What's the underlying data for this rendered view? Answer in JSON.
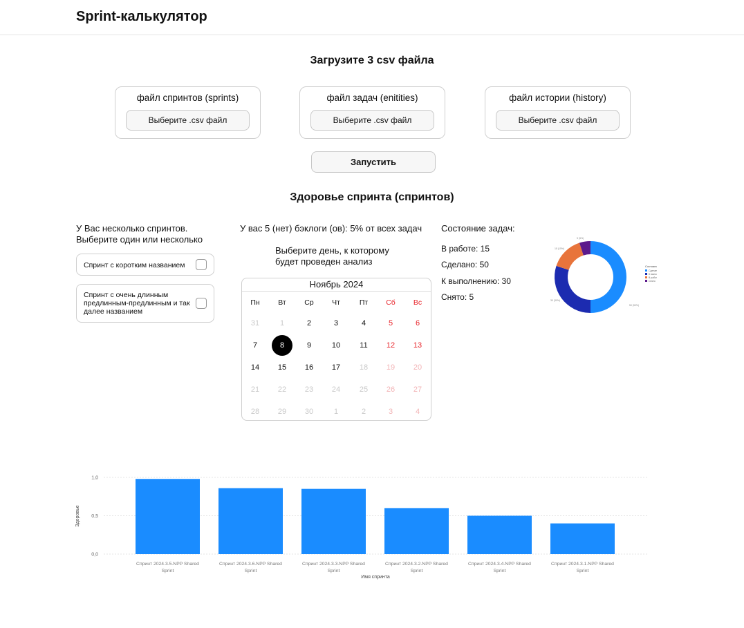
{
  "app": {
    "title": "Sprint-калькулятор"
  },
  "upload": {
    "heading": "Загрузите 3 csv файла",
    "cards": [
      {
        "title": "файл спринтов (sprints)",
        "button": "Выберите .csv файл"
      },
      {
        "title": "файл задач (enitities)",
        "button": "Выберите .csv файл"
      },
      {
        "title": "файл истории (history)",
        "button": "Выберите .csv файл"
      }
    ],
    "run_label": "Запустить"
  },
  "health": {
    "heading": "Здоровье спринта (спринтов)"
  },
  "sprints": {
    "prompt_line1": "У Вас несколько спринтов.",
    "prompt_line2": "Выберите один или несколько",
    "options": [
      {
        "label": "Спринт с коротким названием",
        "checked": false
      },
      {
        "label": "Спринт с очень длинным предлинным-предлинным и так далее названием",
        "checked": false
      }
    ]
  },
  "backlog": {
    "text": "У вас 5 (нет) бэклоги (ов): 5% от всех задач"
  },
  "day_picker": {
    "prompt_line1": "Выберите день, к которому",
    "prompt_line2": "будет проведен анализ",
    "month_label": "Ноябрь 2024",
    "weekdays": [
      "Пн",
      "Вт",
      "Ср",
      "Чт",
      "Пт",
      "Сб",
      "Вс"
    ],
    "weeks": [
      [
        "31",
        "1",
        "2",
        "3",
        "4",
        "5",
        "6"
      ],
      [
        "7",
        "8",
        "9",
        "10",
        "11",
        "12",
        "13"
      ],
      [
        "14",
        "15",
        "16",
        "17",
        "18",
        "19",
        "20"
      ],
      [
        "21",
        "22",
        "23",
        "24",
        "25",
        "26",
        "27"
      ],
      [
        "28",
        "29",
        "30",
        "1",
        "2",
        "3",
        "4"
      ]
    ],
    "muted": [
      [
        0,
        0
      ],
      [
        0,
        1
      ],
      [
        2,
        4
      ],
      [
        2,
        5
      ],
      [
        2,
        6
      ],
      [
        3,
        0
      ],
      [
        3,
        1
      ],
      [
        3,
        2
      ],
      [
        3,
        3
      ],
      [
        3,
        4
      ],
      [
        3,
        5
      ],
      [
        3,
        6
      ],
      [
        4,
        0
      ],
      [
        4,
        1
      ],
      [
        4,
        2
      ],
      [
        4,
        3
      ],
      [
        4,
        4
      ],
      [
        4,
        5
      ],
      [
        4,
        6
      ]
    ],
    "selected": [
      1,
      1
    ],
    "selected_day": "8",
    "colors": {
      "weekend": "#e8252b",
      "selected_bg": "#000000"
    }
  },
  "task_status": {
    "heading": "Состояние задач:",
    "lines": [
      "В работе:  15",
      "Сделано: 50",
      "К выполнению: 30",
      "Снято: 5"
    ]
  },
  "chart_data": [
    {
      "type": "pie",
      "variant": "donut",
      "title": "",
      "legend_title": "Состояние задач",
      "legend_position": "right",
      "categories": [
        "Сделано",
        "К выполнению",
        "В работе",
        "Снято"
      ],
      "values": [
        50,
        30,
        15,
        5
      ],
      "slice_labels": [
        "50 (50%)",
        "30 (30%)",
        "15 (15%)",
        "5 (5%)"
      ],
      "colors": [
        "#1a8cff",
        "#1c2bb0",
        "#e8743b",
        "#5c1a8c"
      ]
    },
    {
      "type": "bar",
      "title": "",
      "xlabel": "Имя спринта",
      "ylabel": "Здоровье",
      "categories": [
        "Спринт 2024.3.5.NPP Shared Sprint",
        "Спринт 2024.3.6.NPP Shared Sprint",
        "Спринт 2024.3.3.NPP Shared Sprint",
        "Спринт 2024.3.2.NPP Shared Sprint",
        "Спринт 2024.3.4.NPP Shared Sprint",
        "Спринт 2024.3.1.NPP Shared Sprint"
      ],
      "values": [
        0.98,
        0.86,
        0.85,
        0.6,
        0.5,
        0.4
      ],
      "ylim": [
        0,
        1.0
      ],
      "yticks": [
        "0,0",
        "0,5",
        "1,0"
      ],
      "grid": true,
      "color": "#1a8cff"
    }
  ]
}
